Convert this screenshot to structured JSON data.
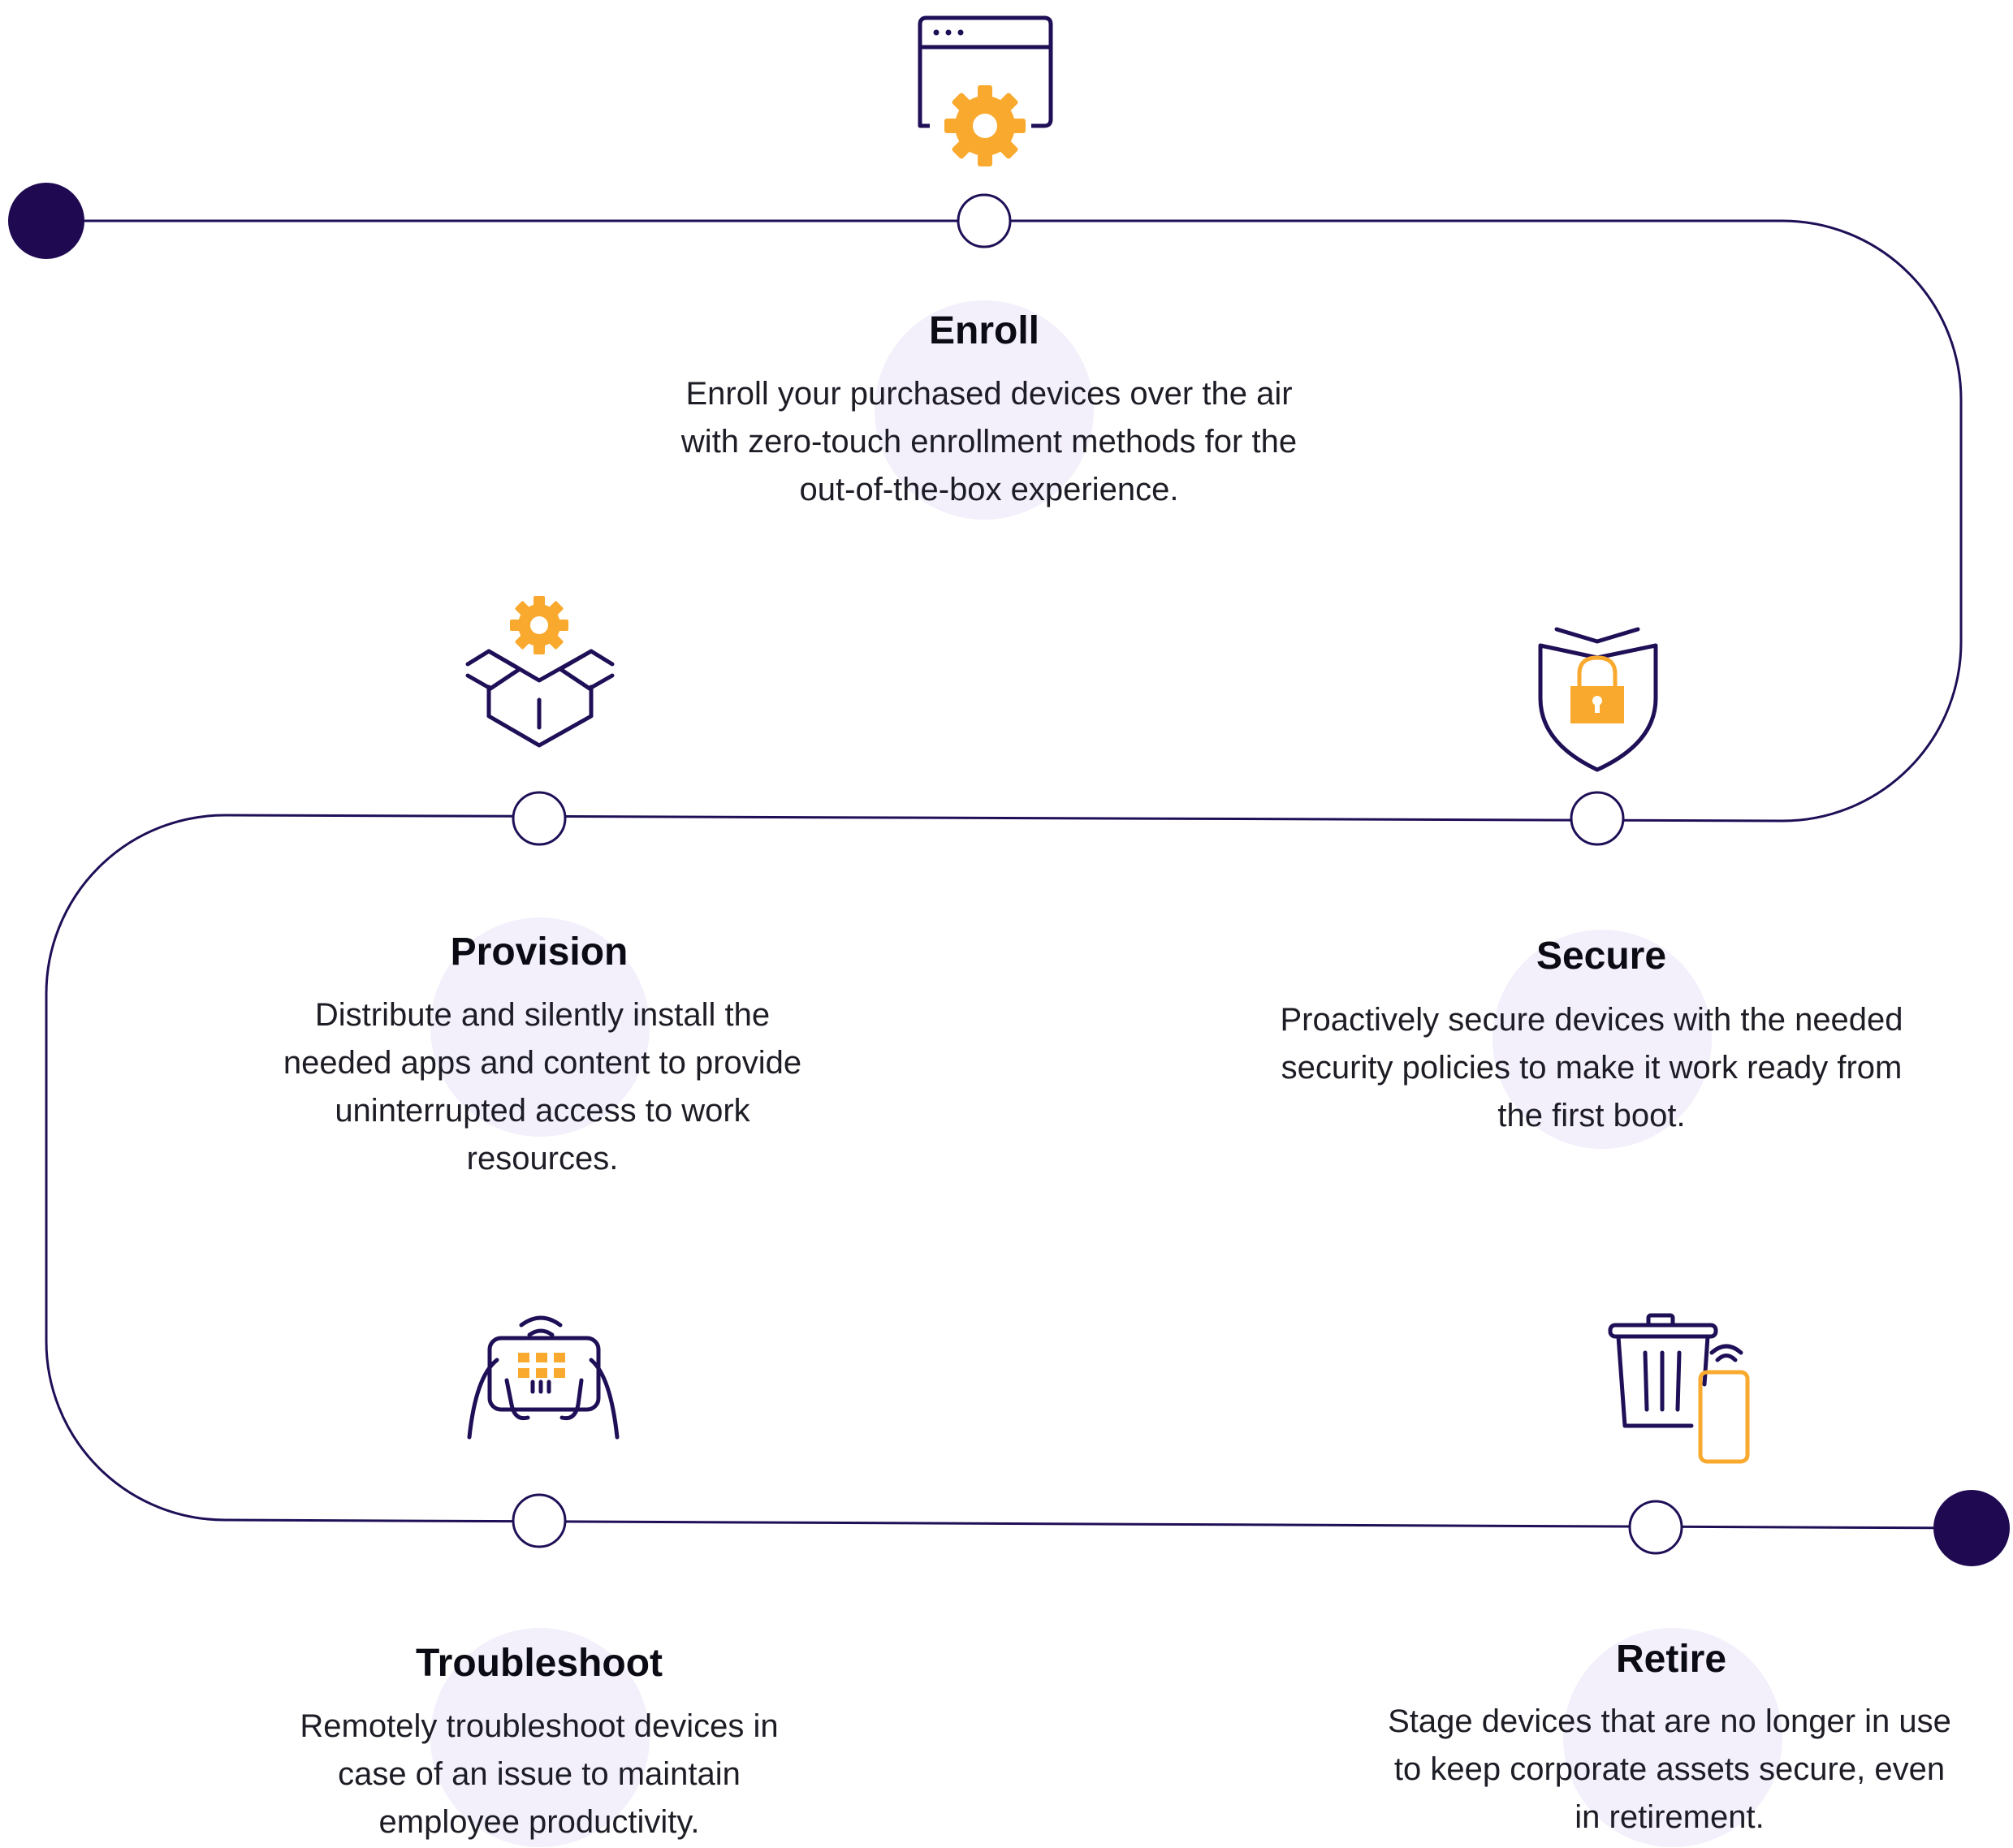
{
  "colors": {
    "path": "#1f0f57",
    "endpoint": "#1f0a52",
    "accent": "#f9aa2e",
    "blob": "#f3effb",
    "text": "#1d1d26"
  },
  "stages": [
    {
      "id": "enroll",
      "icon": "browser-gear-icon",
      "title": "Enroll",
      "description": "Enroll your purchased devices over the air with zero-touch enrollment methods for the out-of-the-box experience."
    },
    {
      "id": "secure",
      "icon": "shield-lock-icon",
      "title": "Secure",
      "description": "Proactively secure devices with the needed security policies to make it work ready from the first boot."
    },
    {
      "id": "provision",
      "icon": "box-gear-icon",
      "title": "Provision",
      "description": "Distribute and silently install the needed apps and content to provide uninterrupted access to work resources."
    },
    {
      "id": "troubleshoot",
      "icon": "tablet-hands-wifi-icon",
      "title": "Troubleshoot",
      "description": "Remotely troubleshoot devices in case of an issue to maintain employee productivity."
    },
    {
      "id": "retire",
      "icon": "trash-phone-icon",
      "title": "Retire",
      "description": "Stage devices that are no longer in use to keep corporate assets secure, even in retirement."
    }
  ]
}
